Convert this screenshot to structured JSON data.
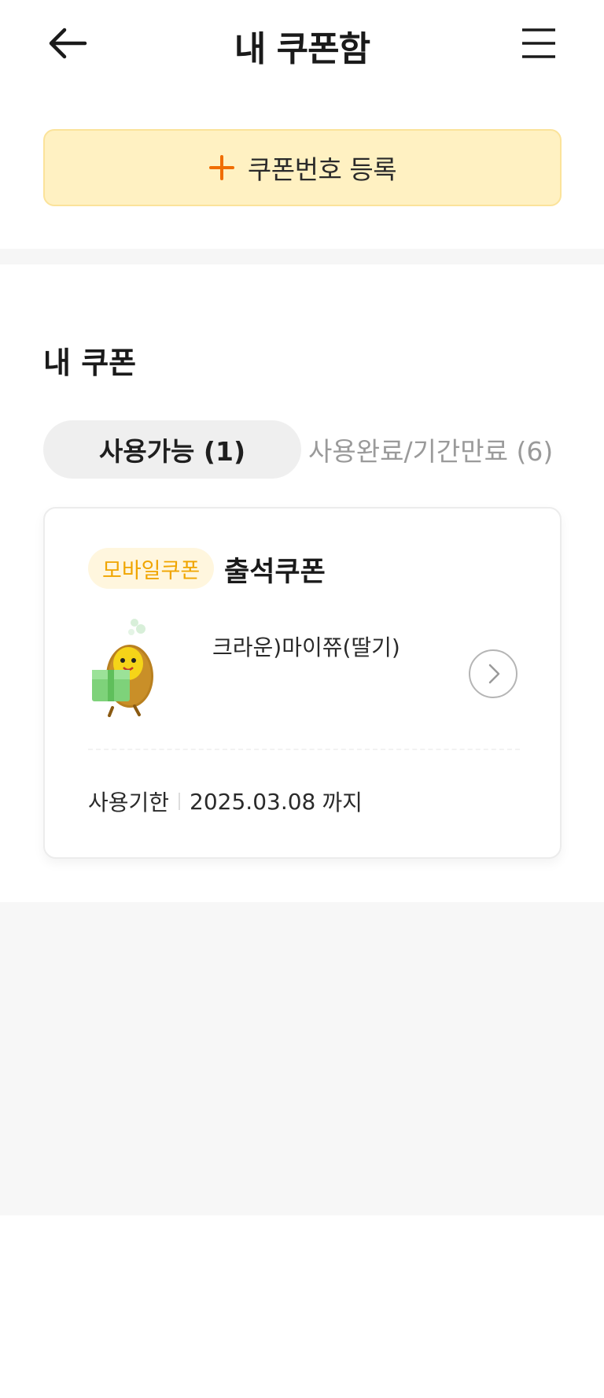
{
  "header": {
    "title": "내 쿠폰함",
    "back_icon": "arrow-left-icon",
    "menu_icon": "hamburger-menu-icon"
  },
  "register": {
    "label": "쿠폰번호 등록",
    "icon": "plus-icon",
    "accent_color": "#f06d00"
  },
  "section": {
    "title": "내 쿠폰"
  },
  "tabs": [
    {
      "label": "사용가능 (1)",
      "active": true
    },
    {
      "label": "사용완료/기간만료 (6)",
      "active": false
    }
  ],
  "coupon": {
    "type_badge": "모바일쿠폰",
    "name": "출석쿠폰",
    "product": "크라운)마이쮸(딸기)",
    "expiry_label": "사용기한",
    "expiry_date": "2025.03.08",
    "expiry_suffix": "까지",
    "mascot_icon": "mascot-gift-icon",
    "detail_icon": "chevron-right-circle-icon",
    "badge_color": "#f0a500"
  }
}
